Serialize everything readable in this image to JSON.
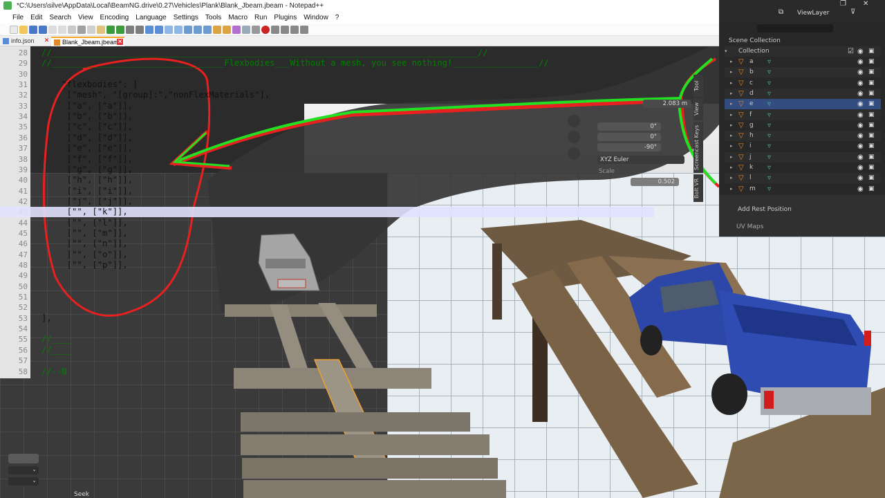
{
  "notepad": {
    "title": "*C:\\Users\\silve\\AppData\\Local\\BeamNG.drive\\0.27\\Vehicles\\Plank\\Blank_Jbeam.jbeam - Notepad++",
    "menu": [
      "File",
      "Edit",
      "Search",
      "View",
      "Encoding",
      "Language",
      "Settings",
      "Tools",
      "Macro",
      "Run",
      "Plugins",
      "Window",
      "?"
    ],
    "tabs": [
      {
        "label": "info.json"
      },
      {
        "label": "Blank_Jbeam.jbeam"
      }
    ],
    "lines": [
      {
        "num": "28",
        "code": "//____________________________________________________________________________________//"
      },
      {
        "num": "29",
        "code": "//__________________________________Flexbodies___Without a mesh, you see nothing!_________________//"
      },
      {
        "num": "30",
        "code": ""
      },
      {
        "num": "31",
        "code": "    \"flexbodies\": ["
      },
      {
        "num": "32",
        "code": "     [\"mesh\", \"[group]:\",\"nonFlexMaterials\"],"
      },
      {
        "num": "33",
        "code": "     [\"a\", [\"a\"]],"
      },
      {
        "num": "34",
        "code": "     [\"b\", [\"b\"]],"
      },
      {
        "num": "35",
        "code": "     [\"c\", [\"c\"]],"
      },
      {
        "num": "36",
        "code": "     [\"d\", [\"d\"]],"
      },
      {
        "num": "37",
        "code": "     [\"e\", [\"e\"]],"
      },
      {
        "num": "38",
        "code": "     [\"f\", [\"f\"]],"
      },
      {
        "num": "39",
        "code": "     [\"g\", [\"g\"]],"
      },
      {
        "num": "40",
        "code": "     [\"h\", [\"h\"]],"
      },
      {
        "num": "41",
        "code": "     [\"i\", [\"i\"]],"
      },
      {
        "num": "42",
        "code": "     [\"j\", [\"j\"]],"
      },
      {
        "num": "43",
        "code": "     [\"\", [\"k\"]],"
      },
      {
        "num": "44",
        "code": "     [\"\", [\"l\"]],"
      },
      {
        "num": "45",
        "code": "     [\"\", [\"m\"]],"
      },
      {
        "num": "46",
        "code": "     [\"\", [\"n\"]],"
      },
      {
        "num": "47",
        "code": "     [\"\", [\"o\"]],"
      },
      {
        "num": "48",
        "code": "     [\"\", [\"p\"]],"
      },
      {
        "num": "49",
        "code": ""
      },
      {
        "num": "50",
        "code": ""
      },
      {
        "num": "51",
        "code": ""
      },
      {
        "num": "52",
        "code": ""
      },
      {
        "num": "53",
        "code": "],"
      },
      {
        "num": "54",
        "code": ""
      },
      {
        "num": "55",
        "code": "//____"
      },
      {
        "num": "56",
        "code": "//____"
      },
      {
        "num": "57",
        "code": ""
      },
      {
        "num": "58",
        "code": "//--N"
      }
    ]
  },
  "blender": {
    "view_layer": "ViewLayer",
    "scene_collection": "Scene Collection",
    "collection": "Collection",
    "objects": [
      "a",
      "b",
      "c",
      "d",
      "e",
      "f",
      "g",
      "h",
      "i",
      "j",
      "k",
      "l",
      "m"
    ],
    "selected_object": "e",
    "properties": {
      "add_rest_position": "Add Rest Position",
      "uv_maps": "UV Maps"
    },
    "npanel": {
      "tabs": [
        "Tool",
        "View",
        "Screencast Keys",
        "Bolt VR"
      ],
      "rotation_labels": [
        "X",
        "Y",
        "Z"
      ],
      "rotation_values": [
        "0°",
        "0°",
        "-90°"
      ],
      "rotation_mode": "XYZ Euler",
      "scale_label": "Scale",
      "scale_value": "0.502",
      "dimension_value": "2.083 m"
    },
    "seek_label": "Seek"
  },
  "colors": {
    "annotation_red": "#e82020",
    "annotation_green": "#22e022",
    "outliner_object": "#e88a2c",
    "outliner_mesh": "#4fc3a1",
    "selection": "#334d80"
  }
}
